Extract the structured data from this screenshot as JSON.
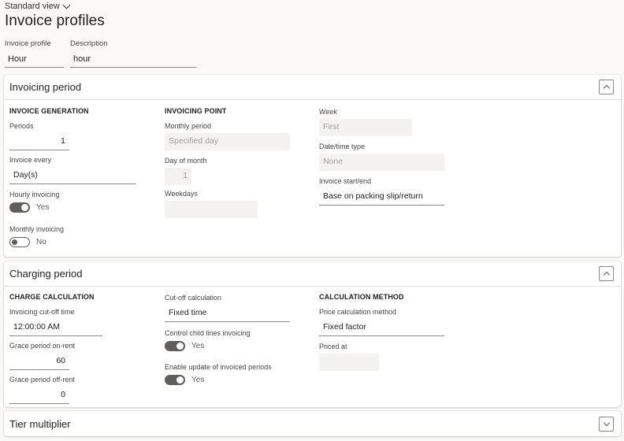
{
  "header": {
    "view_label": "Standard view",
    "title": "Invoice profiles",
    "fields": [
      {
        "label": "Invoice profile",
        "value": "Hour"
      },
      {
        "label": "Description",
        "value": "hour"
      }
    ]
  },
  "invoicing_period": {
    "title": "Invoicing period",
    "expanded": true,
    "invoice_generation": {
      "title": "INVOICE GENERATION",
      "periods_label": "Periods",
      "periods_value": "1",
      "invoice_every_label": "Invoice every",
      "invoice_every_value": "Day(s)",
      "hourly_label": "Hourly invoicing",
      "hourly_value": "Yes",
      "monthly_label": "Monthly invoicing",
      "monthly_value": "No"
    },
    "invoicing_point": {
      "title": "INVOICING POINT",
      "monthly_period_label": "Monthly period",
      "monthly_period_value": "Specified day",
      "day_of_month_label": "Day of month",
      "day_of_month_value": "1",
      "weekdays_label": "Weekdays",
      "weekdays_value": ""
    },
    "other": {
      "week_label": "Week",
      "week_value": "First",
      "datetime_type_label": "Date/time type",
      "datetime_type_value": "None",
      "start_end_label": "Invoice start/end",
      "start_end_value": "Base on packing slip/return"
    }
  },
  "charging_period": {
    "title": "Charging period",
    "expanded": true,
    "charge_calculation": {
      "title": "CHARGE CALCULATION",
      "cutoff_time_label": "Invoicing cut-off time",
      "cutoff_time_value": "12:00:00 AM",
      "grace_on_label": "Grace period on-rent",
      "grace_on_value": "60",
      "grace_off_label": "Grace period off-rent",
      "grace_off_value": "0"
    },
    "middle": {
      "cutoff_calc_label": "Cut-off calculation",
      "cutoff_calc_value": "Fixed time",
      "control_child_label": "Control child lines invoicing",
      "control_child_value": "Yes",
      "enable_update_label": "Enable update of invoiced periods",
      "enable_update_value": "Yes"
    },
    "calculation_method": {
      "title": "CALCULATION METHOD",
      "price_method_label": "Price calculation method",
      "price_method_value": "Fixed factor",
      "priced_at_label": "Priced at",
      "priced_at_value": ""
    }
  },
  "tier_multiplier": {
    "title": "Tier multiplier",
    "expanded": false
  }
}
